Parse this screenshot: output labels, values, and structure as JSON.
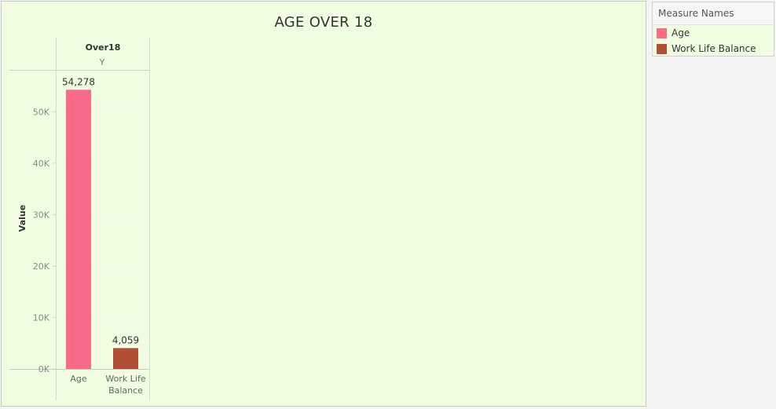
{
  "chart_data": {
    "type": "bar",
    "title": "AGE OVER 18",
    "column_field": "Over18",
    "column_value": "Y",
    "ylabel": "Value",
    "xlabel": "",
    "categories": [
      "Age",
      "Work Life Balance"
    ],
    "category_labels": [
      [
        "Age"
      ],
      [
        "Work Life",
        "Balance"
      ]
    ],
    "values": [
      54278,
      4059
    ],
    "value_labels": [
      "54,278",
      "4,059"
    ],
    "ylim": [
      0,
      58000
    ],
    "yticks": [
      0,
      10000,
      20000,
      30000,
      40000,
      50000
    ],
    "ytick_labels": [
      "0K",
      "10K",
      "20K",
      "30K",
      "40K",
      "50K"
    ],
    "colors": [
      "#f76a88",
      "#b24e35"
    ],
    "grid": true,
    "legend_position": "top-right"
  },
  "legend": {
    "title": "Measure Names",
    "items": [
      {
        "label": "Age",
        "color": "#f76a88"
      },
      {
        "label": "Work Life Balance",
        "color": "#b24e35"
      }
    ]
  }
}
